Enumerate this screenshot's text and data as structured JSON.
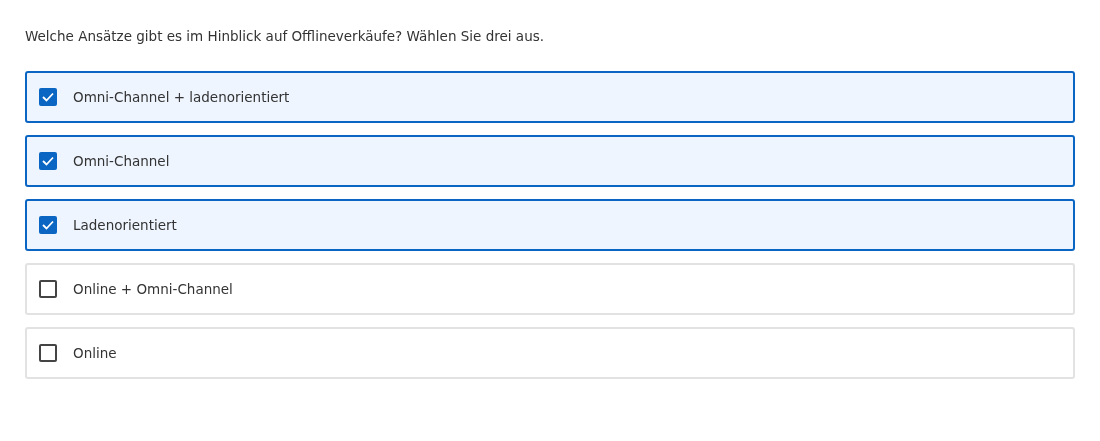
{
  "question": "Welche Ansätze gibt es im Hinblick auf Offlineverkäufe? Wählen Sie drei aus.",
  "options": [
    {
      "label": "Omni-Channel + ladenorientiert",
      "checked": true
    },
    {
      "label": "Omni-Channel",
      "checked": true
    },
    {
      "label": "Ladenorientiert",
      "checked": true
    },
    {
      "label": "Online + Omni-Channel",
      "checked": false
    },
    {
      "label": "Online",
      "checked": false
    }
  ]
}
